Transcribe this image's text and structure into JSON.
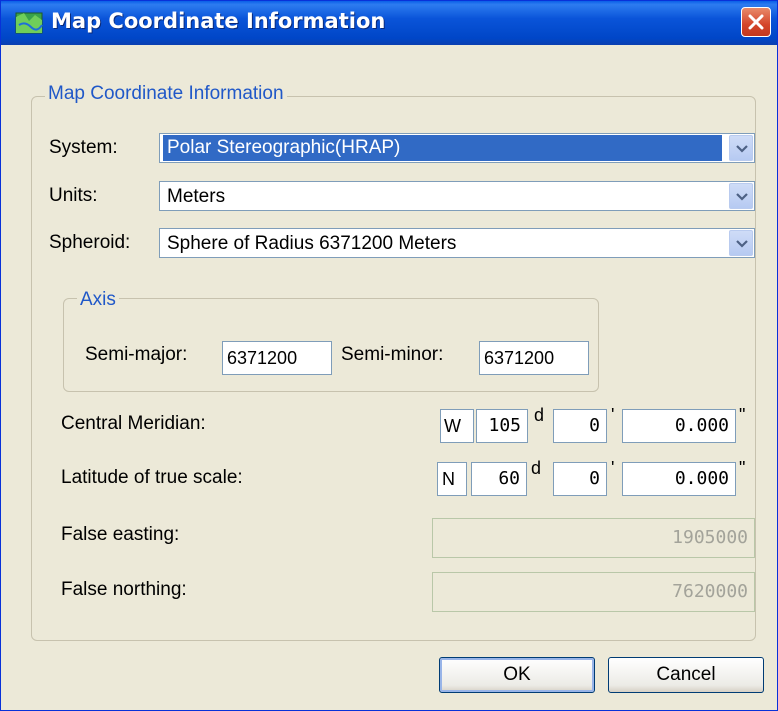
{
  "window": {
    "title": "Map Coordinate Information",
    "close_icon": "close-icon",
    "app_icon": "map-icon"
  },
  "group": {
    "legend": "Map Coordinate Information",
    "system": {
      "label": "System:",
      "value": "Polar Stereographic(HRAP)"
    },
    "units": {
      "label": "Units:",
      "value": "Meters"
    },
    "spheroid": {
      "label": "Spheroid:",
      "value": "Sphere of Radius 6371200 Meters"
    },
    "axis": {
      "legend": "Axis",
      "semi_major_label": "Semi-major:",
      "semi_major_value": "6371200",
      "semi_minor_label": "Semi-minor:",
      "semi_minor_value": "6371200"
    },
    "central_meridian": {
      "label": "Central Meridian:",
      "hemisphere": "W",
      "degrees": "105",
      "deg_symbol": "d",
      "minutes": "0",
      "min_symbol": "'",
      "seconds": "0.000",
      "sec_symbol": "\""
    },
    "latitude": {
      "label": "Latitude of true scale:",
      "hemisphere": "N",
      "degrees": "60",
      "deg_symbol": "d",
      "minutes": "0",
      "min_symbol": "'",
      "seconds": "0.000",
      "sec_symbol": "\""
    },
    "false_easting": {
      "label": "False easting:",
      "value": "1905000"
    },
    "false_northing": {
      "label": "False northing:",
      "value": "7620000"
    }
  },
  "buttons": {
    "ok": "OK",
    "cancel": "Cancel"
  },
  "colors": {
    "titlebar": "#0a54d9",
    "accent_text": "#2058c8",
    "selection": "#316ac5",
    "dialog_bg": "#ece9d8"
  }
}
